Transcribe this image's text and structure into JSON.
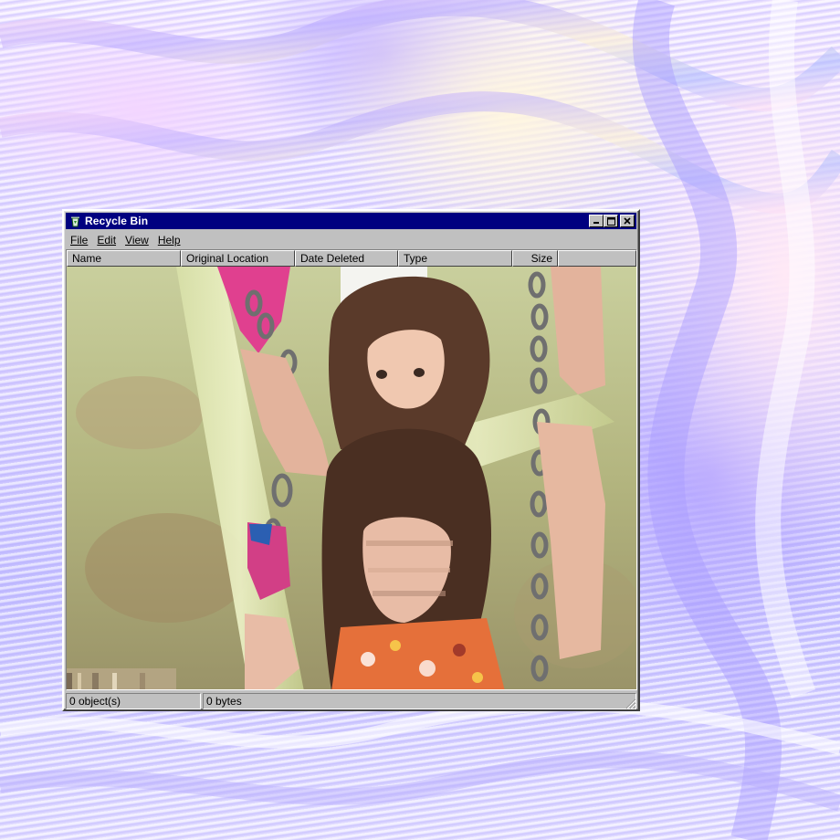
{
  "window": {
    "title": "Recycle Bin",
    "controls": {
      "minimize": "_",
      "maximize": "□",
      "close": "×"
    }
  },
  "menu": [
    {
      "label": "File"
    },
    {
      "label": "Edit"
    },
    {
      "label": "View"
    },
    {
      "label": "Help"
    }
  ],
  "columns": [
    {
      "label": "Name"
    },
    {
      "label": "Original Location"
    },
    {
      "label": "Date Deleted"
    },
    {
      "label": "Type"
    },
    {
      "label": "Size"
    }
  ],
  "content": {
    "image_icon": "glitched-photo"
  },
  "status": {
    "objects": "0 object(s)",
    "bytes": "0 bytes"
  },
  "colors": {
    "titlebar": "#000080",
    "window_face": "#c0c0c0",
    "background_pastel": "#c7c2ff"
  }
}
